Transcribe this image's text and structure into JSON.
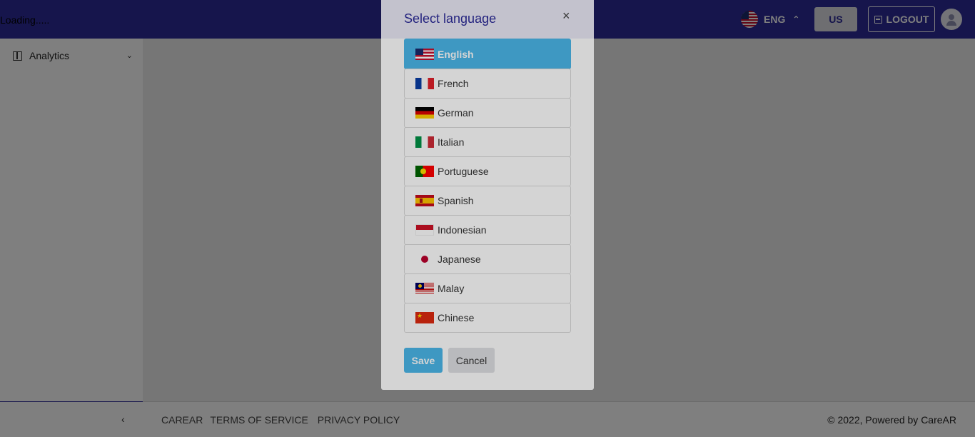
{
  "header": {
    "loading_text": "Loading.....",
    "language_code": "ENG",
    "region_button": "US",
    "logout_label": "LOGOUT",
    "language_icon": "us-flag-icon"
  },
  "sidebar": {
    "items": [
      {
        "label": "Analytics",
        "icon": "layout-icon",
        "expanded": false
      }
    ]
  },
  "footer": {
    "links": [
      "CAREAR",
      "TERMS OF SERVICE",
      "PRIVACY POLICY"
    ],
    "copyright": "© 2022, Powered by CareAR"
  },
  "modal": {
    "title": "Select language",
    "close_symbol": "×",
    "languages": [
      {
        "label": "English",
        "flag": "us",
        "selected": true
      },
      {
        "label": "French",
        "flag": "fr",
        "selected": false
      },
      {
        "label": "German",
        "flag": "de",
        "selected": false
      },
      {
        "label": "Italian",
        "flag": "it",
        "selected": false
      },
      {
        "label": "Portuguese",
        "flag": "pt",
        "selected": false
      },
      {
        "label": "Spanish",
        "flag": "es",
        "selected": false
      },
      {
        "label": "Indonesian",
        "flag": "id",
        "selected": false
      },
      {
        "label": "Japanese",
        "flag": "jp",
        "selected": false
      },
      {
        "label": "Malay",
        "flag": "my",
        "selected": false
      },
      {
        "label": "Chinese",
        "flag": "cn",
        "selected": false
      }
    ],
    "save_label": "Save",
    "cancel_label": "Cancel"
  },
  "colors": {
    "topbar": "#2c2b99",
    "accent": "#4bb7ea",
    "modal_header": "#ebeaf7"
  }
}
